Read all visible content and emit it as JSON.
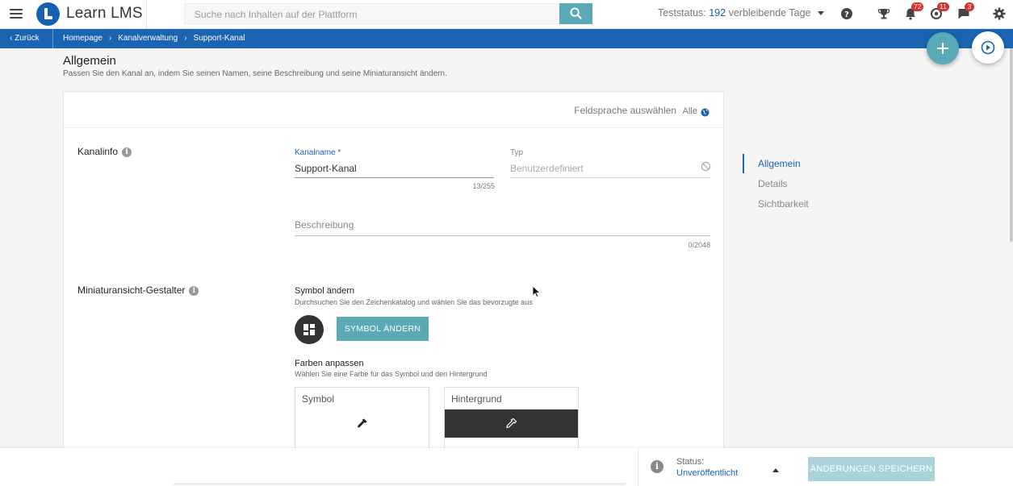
{
  "header": {
    "app_name": "Learn LMS",
    "search_placeholder": "Suche nach Inhalten auf der Plattform",
    "trial_prefix": "Teststatus:",
    "trial_days": "192",
    "trial_suffix": "verbleibende Tage",
    "badges": {
      "notifications": "72",
      "learners": "11",
      "messages": "3"
    }
  },
  "breadcrumb": {
    "back_label": "Zurück",
    "items": [
      "Homepage",
      "Kanalverwaltung",
      "Support-Kanal"
    ]
  },
  "page": {
    "title": "Allgemein",
    "subtitle": "Passen Sie den Kanal an, indem Sie seinen Namen, seine Beschreibung und seine Miniaturansicht ändern."
  },
  "card": {
    "language_label": "Feldsprache auswählen",
    "language_value": "Alle",
    "kanalinfo": {
      "title": "Kanalinfo",
      "name_label": "Kanalname *",
      "name_value": "Support-Kanal",
      "name_counter": "13/255",
      "type_label": "Typ",
      "type_value": "Benutzerdefiniert",
      "description_placeholder": "Beschreibung",
      "description_counter": "0/2048"
    },
    "thumbnail": {
      "title": "Miniaturansicht-Gestalter",
      "symbol_title": "Symbol ändern",
      "symbol_desc": "Durchsuchen Sie den Zeichenkatalog und wählen Sie das bevorzugte aus",
      "symbol_button": "SYMBOL ÄNDERN",
      "colors_title": "Farben anpassen",
      "colors_desc": "Wählen Sie eine Farbe für das Symbol und den Hintergrund",
      "symbol_color_label": "Symbol",
      "symbol_color": "#ffffff",
      "background_color_label": "Hintergrund",
      "background_color": "#333333"
    }
  },
  "section_nav": {
    "items": [
      "Allgemein",
      "Details",
      "Sichtbarkeit"
    ],
    "active": "Allgemein"
  },
  "footer": {
    "status_label": "Status:",
    "status_value": "Unveröffentlicht",
    "save_label": "ÄNDERUNGEN SPEICHERN"
  },
  "colors": {
    "primary_blue": "#1a64b1",
    "teal": "#5aa9b6",
    "teal_disabled": "#a9d3d9",
    "badge_red": "#d9342b"
  }
}
